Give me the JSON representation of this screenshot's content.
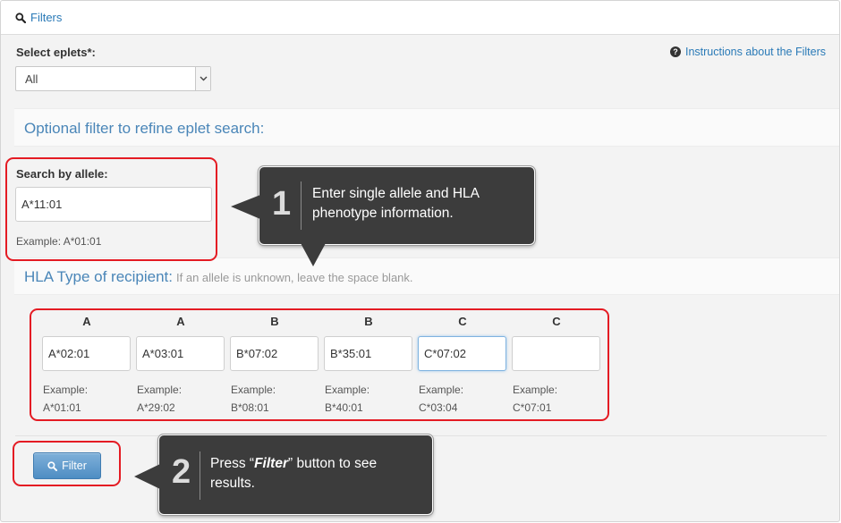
{
  "header": {
    "title": "Filters"
  },
  "select_eplets": {
    "label": "Select eplets*:",
    "value": "All"
  },
  "instructions_link": "Instructions about the Filters",
  "optional_filter_title": "Optional filter to refine eplet search:",
  "search_allele": {
    "label": "Search by allele:",
    "value": "A*11:01",
    "example": "Example: A*01:01"
  },
  "hla_type": {
    "title": "HLA Type of recipient:",
    "subtitle": "If an allele is unknown, leave the space blank.",
    "columns": [
      {
        "header": "A",
        "value": "A*02:01",
        "example_label": "Example:",
        "example_value": "A*01:01"
      },
      {
        "header": "A",
        "value": "A*03:01",
        "example_label": "Example:",
        "example_value": "A*29:02"
      },
      {
        "header": "B",
        "value": "B*07:02",
        "example_label": "Example:",
        "example_value": "B*08:01"
      },
      {
        "header": "B",
        "value": "B*35:01",
        "example_label": "Example:",
        "example_value": "B*40:01"
      },
      {
        "header": "C",
        "value": "C*07:02",
        "example_label": "Example:",
        "example_value": "C*03:04"
      },
      {
        "header": "C",
        "value": "",
        "example_label": "Example:",
        "example_value": "C*07:01"
      }
    ]
  },
  "filter_button": {
    "label": "Filter"
  },
  "callouts": [
    {
      "number": "1",
      "text": "Enter single allele and HLA phenotype information."
    },
    {
      "number": "2",
      "text_before": "Press “",
      "text_emph": "Filter",
      "text_after": "” button to see results."
    }
  ],
  "colors": {
    "link": "#2a7ab7",
    "section_title": "#4a86b8",
    "highlight_box": "#e41b23",
    "callout_bg": "#3c3c3c",
    "button": "#5a97cb"
  },
  "icons": {
    "header": "search-icon",
    "instructions": "question-circle-icon",
    "select": "chevron-down-icon",
    "button": "search-icon"
  }
}
